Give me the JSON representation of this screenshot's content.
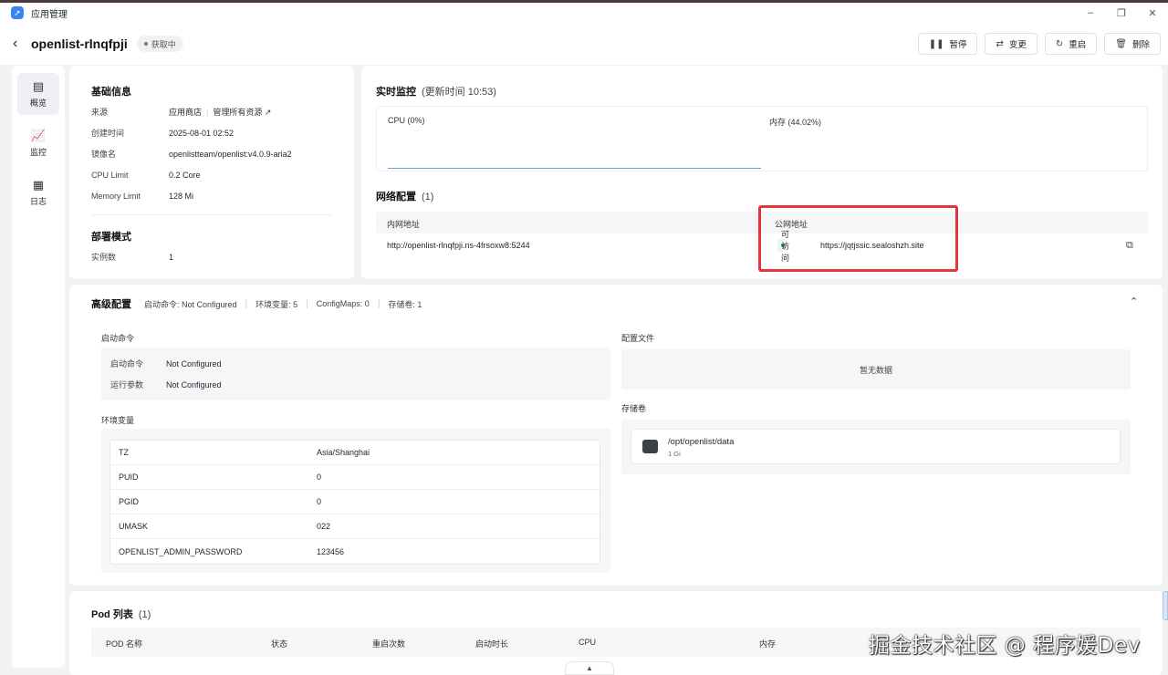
{
  "window": {
    "title": "应用管理",
    "icon": "rocket-icon"
  },
  "header": {
    "app_name": "openlist-rlnqfpji",
    "status": "获取中"
  },
  "actions": [
    {
      "label": "暂停",
      "icon": "pause-icon"
    },
    {
      "label": "变更",
      "icon": "swap-icon"
    },
    {
      "label": "重启",
      "icon": "restart-icon"
    },
    {
      "label": "删除",
      "icon": "trash-icon"
    }
  ],
  "sidebar": {
    "items": [
      {
        "label": "概览",
        "icon": "overview-icon"
      },
      {
        "label": "监控",
        "icon": "chart-icon"
      },
      {
        "label": "日志",
        "icon": "log-icon"
      }
    ]
  },
  "basic": {
    "title": "基础信息",
    "rows": [
      {
        "key": "来源",
        "value": "应用商店"
      },
      {
        "key": "创建时间",
        "value": "2025-08-01 02:52"
      },
      {
        "key": "镜像名",
        "value": "openlistteam/openlist:v4.0.9-aria2"
      },
      {
        "key": "CPU Limit",
        "value": "0.2 Core"
      },
      {
        "key": "Memory Limit",
        "value": "128 Mi"
      }
    ],
    "manage_link": "管理所有资源 ↗",
    "deploy_title": "部署模式",
    "deploy_key": "实例数",
    "deploy_value": "1"
  },
  "monitor": {
    "title": "实时监控",
    "updated": "(更新时间  10:53)",
    "cpu_label": "CPU  (0%)",
    "mem_label": "内存  (44.02%)"
  },
  "network": {
    "title": "网络配置",
    "count": "(1)",
    "col_internal": "内网地址",
    "col_public": "公网地址",
    "internal": "http://openlist-rlnqfpji.ns-4frsoxw8:5244",
    "badge": "可访问",
    "public": "https://jqtjssic.sealoshzh.site"
  },
  "advanced": {
    "title": "高级配置",
    "summary": [
      "启动命令: Not Configured",
      "环境变量: 5",
      "ConfigMaps: 0",
      "存储卷: 1"
    ],
    "startup_title": "启动命令",
    "startup_rows": [
      {
        "key": "启动命令",
        "value": "Not Configured"
      },
      {
        "key": "运行参数",
        "value": "Not Configured"
      }
    ],
    "env_title": "环境变量",
    "env": [
      {
        "name": "TZ",
        "value": "Asia/Shanghai"
      },
      {
        "name": "PUID",
        "value": "0"
      },
      {
        "name": "PGID",
        "value": "0"
      },
      {
        "name": "UMASK",
        "value": "022"
      },
      {
        "name": "OPENLIST_ADMIN_PASSWORD",
        "value": "123456"
      }
    ],
    "config_title": "配置文件",
    "config_empty": "暂无数据",
    "storage_title": "存储卷",
    "volume_path": "/opt/openlist/data",
    "volume_size": "1 Gi"
  },
  "pods": {
    "title": "Pod 列表",
    "count": "(1)",
    "columns": [
      "POD 名称",
      "状态",
      "重启次数",
      "启动时长",
      "CPU",
      "内存"
    ]
  },
  "watermark": "掘金技术社区 @ 程序媛Dev"
}
